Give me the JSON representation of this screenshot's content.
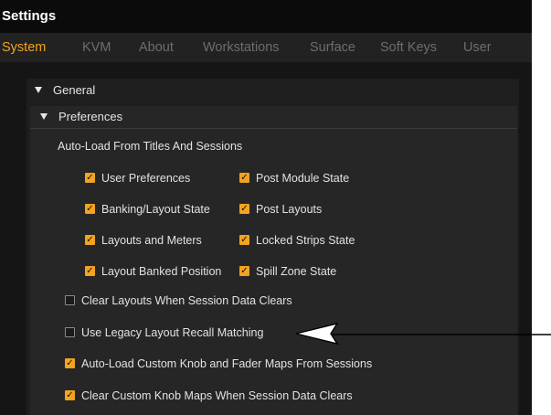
{
  "window": {
    "title": "Settings"
  },
  "tabs": [
    {
      "label": "System",
      "active": true
    },
    {
      "label": "KVM",
      "active": false
    },
    {
      "label": "About",
      "active": false
    },
    {
      "label": "Workstations",
      "active": false
    },
    {
      "label": "Surface",
      "active": false
    },
    {
      "label": "Soft Keys",
      "active": false
    },
    {
      "label": "User",
      "active": false
    }
  ],
  "general": {
    "label": "General",
    "preferences": {
      "label": "Preferences",
      "auto_load": {
        "label": "Auto-Load From Titles And Sessions",
        "options": [
          {
            "label": "User Preferences",
            "checked": true
          },
          {
            "label": "Post Module State",
            "checked": true
          },
          {
            "label": "Banking/Layout State",
            "checked": true
          },
          {
            "label": "Post Layouts",
            "checked": true
          },
          {
            "label": "Layouts and Meters",
            "checked": true
          },
          {
            "label": "Locked Strips State",
            "checked": true
          },
          {
            "label": "Layout Banked Position",
            "checked": true
          },
          {
            "label": "Spill Zone State",
            "checked": true
          }
        ]
      },
      "options": [
        {
          "label": "Clear Layouts When Session Data Clears",
          "checked": false
        },
        {
          "label": "Use Legacy Layout Recall Matching",
          "checked": false
        },
        {
          "label": "Auto-Load Custom Knob and Fader Maps From Sessions",
          "checked": true
        },
        {
          "label": "Clear Custom Knob Maps When Session Data Clears",
          "checked": true
        }
      ]
    }
  },
  "colors": {
    "accent": "#f2a31f",
    "window_bg": "#151515",
    "title_bg": "#0b0b0b",
    "tabbar_bg": "#222222",
    "text": "#e2e2e2",
    "annotation_arrow": "#000000"
  },
  "annotation": {
    "type": "arrow",
    "points_to": "Use Legacy Layout Recall Matching"
  }
}
